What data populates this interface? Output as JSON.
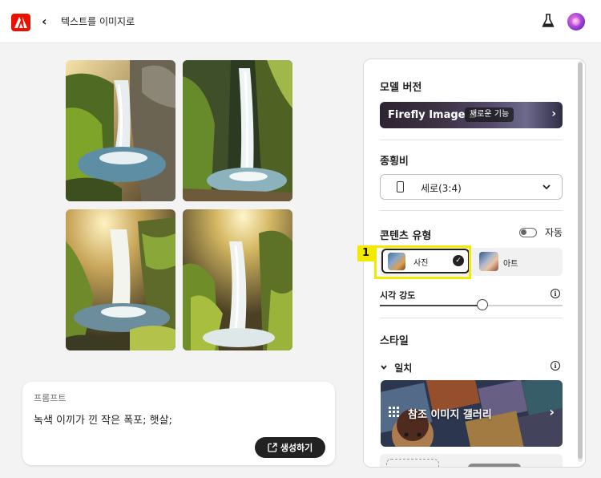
{
  "header": {
    "title": "텍스트를 이미지로",
    "back_glyph": "‹",
    "logo_icon": "adobe-logo",
    "labs_icon": "flask-icon",
    "avatar_icon": "user-avatar"
  },
  "images": [
    {
      "name": "generated-image-1"
    },
    {
      "name": "generated-image-2"
    },
    {
      "name": "generated-image-3"
    },
    {
      "name": "generated-image-4"
    }
  ],
  "prompt": {
    "label": "프롬프트",
    "value": "녹색 이끼가 낀 작은 폭포; 햇살;",
    "generate_label": "생성하기"
  },
  "panel": {
    "model_title": "모델 버전",
    "model_name": "Firefly Image 2",
    "model_badge": "새로운 기능",
    "ratio_title": "종횡비",
    "ratio_value": "세로(3:4)",
    "content_title": "콘텐츠 유형",
    "auto_label": "자동",
    "photo_label": "사진",
    "art_label": "아트",
    "strength_label": "시각 강도",
    "strength_value": 0.56,
    "style_title": "스타일",
    "match_label": "일치",
    "gallery_label": "참조 이미지 갤러리"
  },
  "annotation": {
    "number": "1",
    "color": "#f2ea00"
  },
  "colors": {
    "brand": "#eb1000",
    "button_dark": "#222222"
  }
}
